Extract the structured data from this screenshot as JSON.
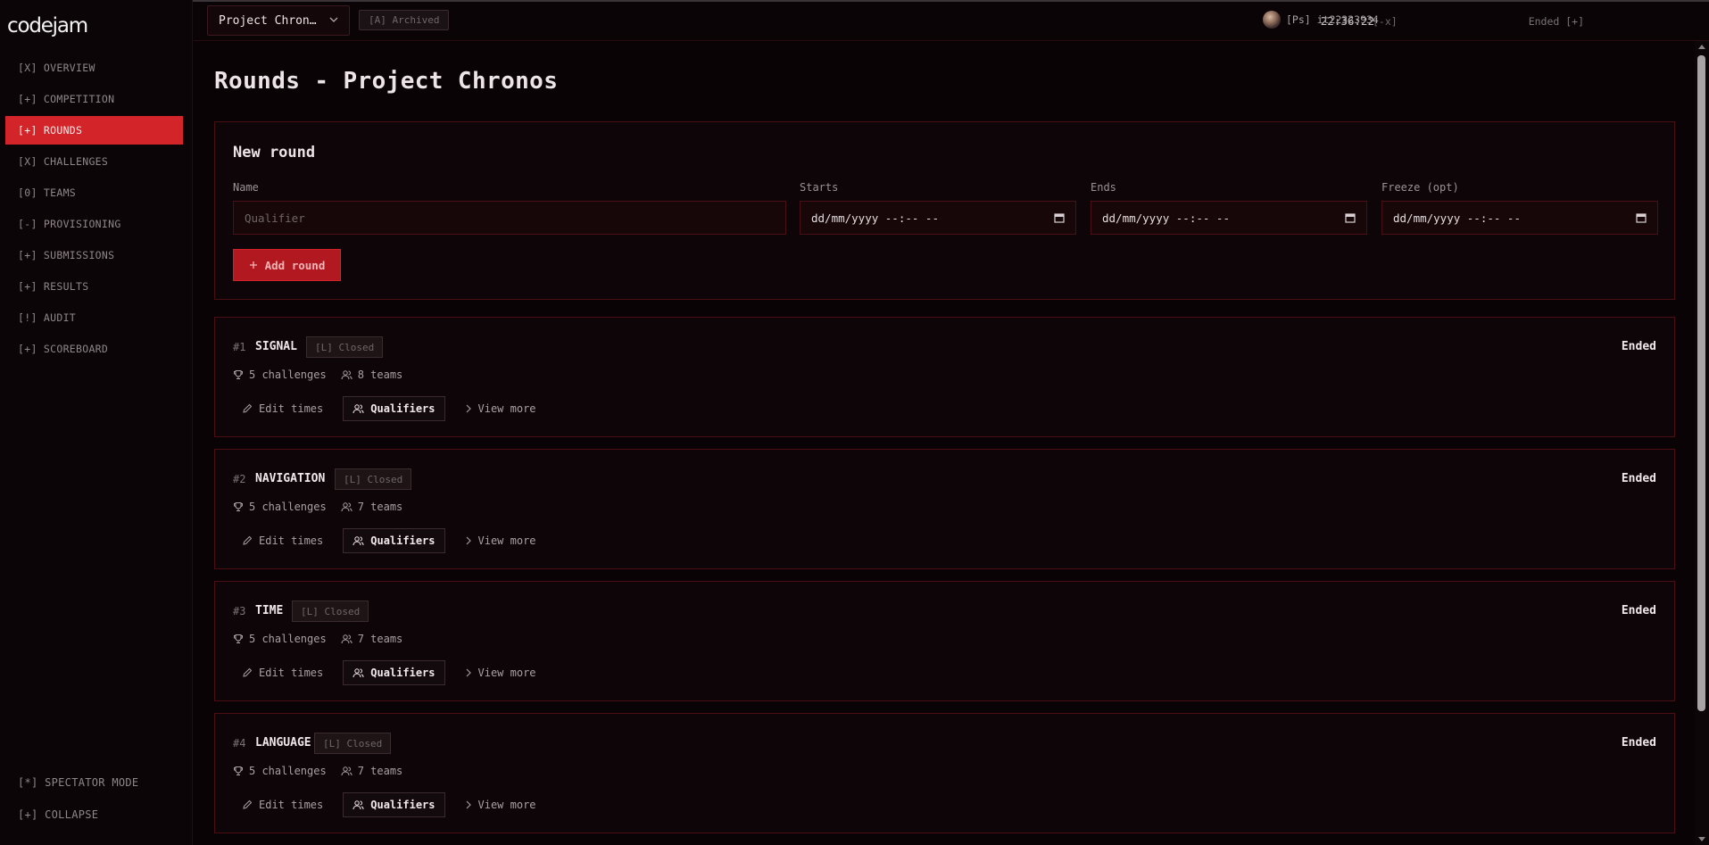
{
  "app": {
    "logo": "codejam"
  },
  "sidebar": {
    "items": [
      {
        "label": "[X] OVERVIEW",
        "active": false
      },
      {
        "label": "[+] COMPETITION",
        "active": false
      },
      {
        "label": "[+] ROUNDS",
        "active": true
      },
      {
        "label": "[X] CHALLENGES",
        "active": false
      },
      {
        "label": "[0] TEAMS",
        "active": false
      },
      {
        "label": "[-] PROVISIONING",
        "active": false
      },
      {
        "label": "[+] SUBMISSIONS",
        "active": false
      },
      {
        "label": "[+] RESULTS",
        "active": false
      },
      {
        "label": "[!] AUDIT",
        "active": false
      },
      {
        "label": "[+] SCOREBOARD",
        "active": false
      }
    ],
    "spectator_mode": "[*] SPECTATOR MODE",
    "collapse": "[+] COLLAPSE"
  },
  "header": {
    "competition": "Project Chron…",
    "archived_badge": "[A] Archived",
    "status": "Ended [+]",
    "time": "22:36:22",
    "user": "[Ps] it22323934",
    "close": "[-x]"
  },
  "page": {
    "title": "Rounds - Project Chronos"
  },
  "new_round": {
    "title": "New round",
    "name_label": "Name",
    "name_placeholder": "Qualifier",
    "starts_label": "Starts",
    "starts_value": "dd/mm/yyyy --:-- --",
    "ends_label": "Ends",
    "ends_value": "dd/mm/yyyy --:-- --",
    "freeze_label": "Freeze (opt)",
    "freeze_value": "dd/mm/yyyy --:-- --",
    "add_button": "Add round"
  },
  "rounds": [
    {
      "num": "#1",
      "name": "SIGNAL",
      "badge": "[L] Closed",
      "status": "Ended",
      "challenges": "5 challenges",
      "teams": "8 teams",
      "edit": "Edit times",
      "qualifiers": "Qualifiers",
      "view_more": "View more"
    },
    {
      "num": "#2",
      "name": "NAVIGATION",
      "badge": "[L] Closed",
      "status": "Ended",
      "challenges": "5 challenges",
      "teams": "7 teams",
      "edit": "Edit times",
      "qualifiers": "Qualifiers",
      "view_more": "View more"
    },
    {
      "num": "#3",
      "name": "TIME",
      "badge": "[L] Closed",
      "status": "Ended",
      "challenges": "5 challenges",
      "teams": "7 teams",
      "edit": "Edit times",
      "qualifiers": "Qualifiers",
      "view_more": "View more"
    },
    {
      "num": "#4",
      "name": "LANGUAGE",
      "badge": "[L] Closed",
      "status": "Ended",
      "challenges": "5 challenges",
      "teams": "7 teams",
      "edit": "Edit times",
      "qualifiers": "Qualifiers",
      "view_more": "View more"
    }
  ],
  "colors": {
    "accent": "#d3242a",
    "panel_border": "#4a0e14",
    "background": "#0a0306"
  }
}
